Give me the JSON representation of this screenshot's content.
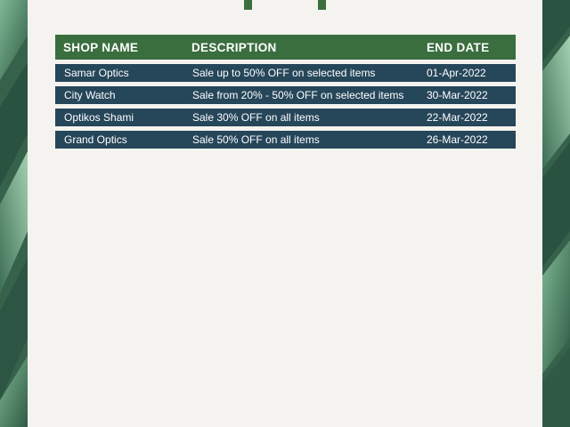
{
  "table": {
    "headers": {
      "shop": "SHOP NAME",
      "description": "DESCRIPTION",
      "end_date": "END DATE"
    },
    "rows": [
      {
        "shop": "Samar Optics",
        "description": "Sale up to 50% OFF on selected items",
        "end_date": "01-Apr-2022"
      },
      {
        "shop": "City Watch",
        "description": "Sale from 20% - 50% OFF on selected items",
        "end_date": "30-Mar-2022"
      },
      {
        "shop": "Optikos Shami",
        "description": "Sale 30% OFF on all items",
        "end_date": "22-Mar-2022"
      },
      {
        "shop": "Grand Optics",
        "description": "Sale 50% OFF on all items",
        "end_date": "26-Mar-2022"
      }
    ]
  },
  "colors": {
    "header_bg": "#3a6e3f",
    "row_bg": "#26465a",
    "panel_bg": "#f4f3ef",
    "leaf_green": "#3f6f55"
  }
}
